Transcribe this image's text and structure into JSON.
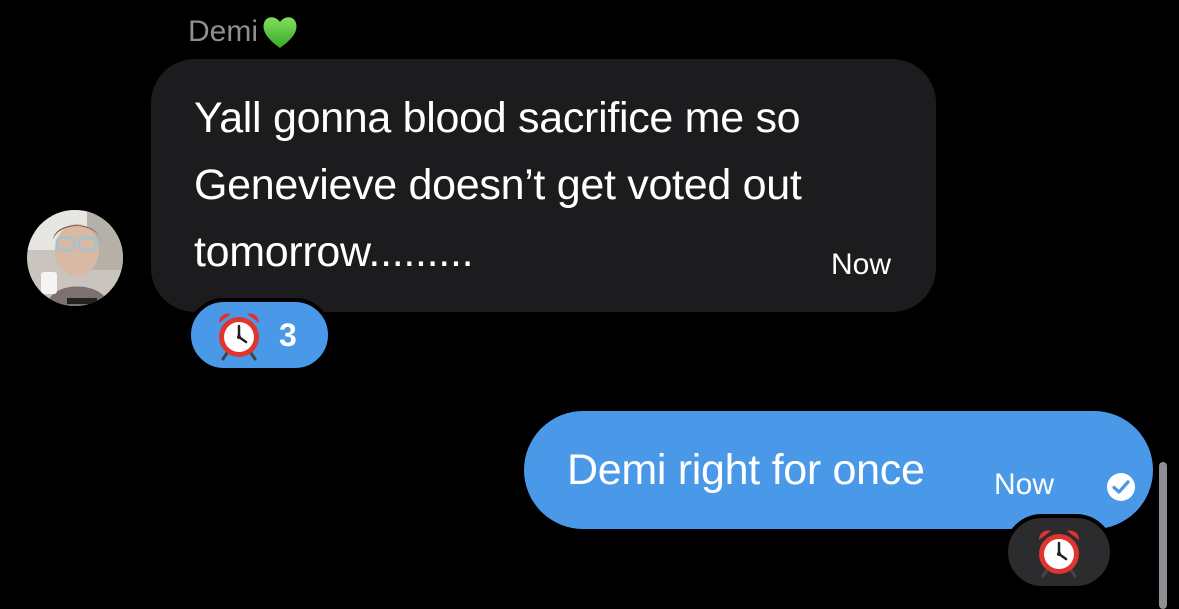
{
  "conversation": {
    "incoming": {
      "sender_name": "Demi",
      "sender_emoji": "green-heart-icon",
      "message": "Yall gonna blood sacrifice me so\nGenevieve doesn’t get voted out\ntomorrow.........",
      "timestamp": "Now",
      "reaction": {
        "emoji": "alarm-clock-icon",
        "count": "3"
      }
    },
    "outgoing": {
      "message": "Demi right for once",
      "timestamp": "Now",
      "status": "sent-check-icon",
      "reaction": {
        "emoji": "alarm-clock-icon"
      }
    }
  },
  "colors": {
    "background": "#000000",
    "incoming_bubble": "#1c1c1e",
    "outgoing_bubble": "#4a98e8",
    "name_gray": "#8e8e93"
  }
}
